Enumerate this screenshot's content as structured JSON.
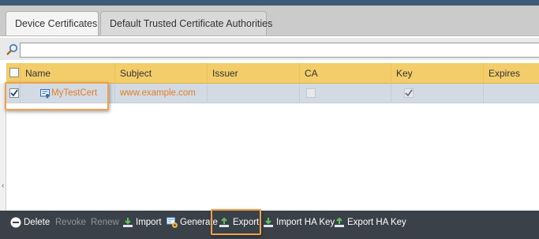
{
  "tabs": [
    {
      "label": "Device Certificates",
      "active": true
    },
    {
      "label": "Default Trusted Certificate Authorities",
      "active": false
    }
  ],
  "search": {
    "value": "",
    "placeholder": ""
  },
  "table": {
    "columns": [
      "Name",
      "Subject",
      "Issuer",
      "CA",
      "Key",
      "Expires"
    ],
    "rows": [
      {
        "selected": true,
        "name": "MyTestCert",
        "subject": "www.example.com",
        "issuer": "",
        "ca": false,
        "key": true,
        "expires": ""
      }
    ]
  },
  "toolbar": {
    "delete": "Delete",
    "revoke": "Revoke",
    "renew": "Renew",
    "import": "Import",
    "generate": "Generate",
    "export": "Export",
    "import_ha_key": "Import HA Key",
    "export_ha_key": "Export HA Key"
  },
  "colors": {
    "header_bg": "#f2cd69",
    "selected_row_bg": "#d2dae3",
    "link": "#e67e22",
    "highlight": "#f0a04b",
    "toolbar_bg": "#3b4148",
    "topbar": "#3d5a76"
  }
}
